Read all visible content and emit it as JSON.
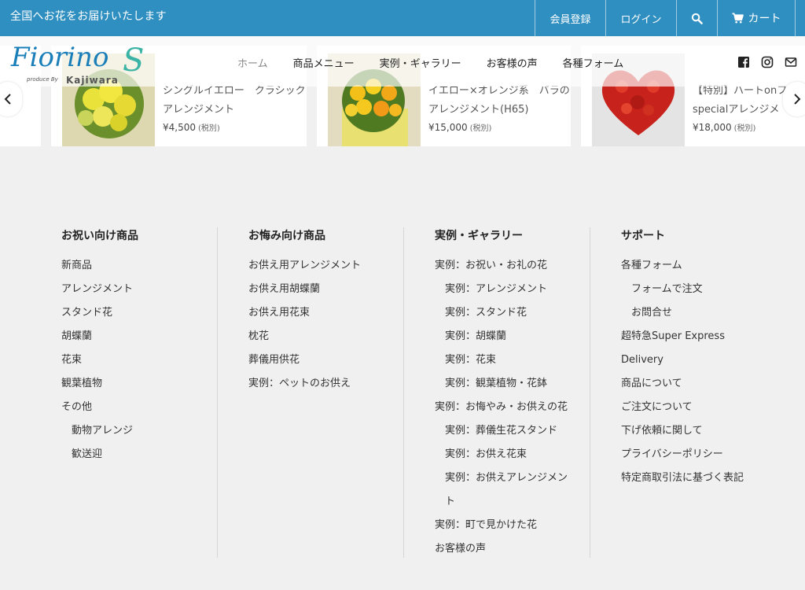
{
  "topbar": {
    "tagline": "全国へお花をお届けいたします",
    "register": "会員登録",
    "login": "ログイン",
    "cart": "カート"
  },
  "logo": {
    "wordmark": "Fiorino",
    "tail": "S",
    "produce_by": "produce By",
    "brand": "Kajiwara"
  },
  "mainnav": [
    "ホーム",
    "商品メニュー",
    "実例・ギャラリー",
    "お客様の声",
    "各種フォーム"
  ],
  "carousel": [
    {
      "name": "シングルイエロー　クラシック　アレンジメント",
      "price": "¥4,500",
      "tax": "(税別)"
    },
    {
      "name": "イエロー×オレンジ系　バラのアレンジメント(H65)",
      "price": "¥15,000",
      "tax": "(税別)"
    },
    {
      "name": "【特別】ハートonファイアーspecialアレンジメ",
      "price": "¥18,000",
      "tax": "(税別)"
    }
  ],
  "footer": {
    "columns": [
      {
        "heading": "お祝い向け商品",
        "items": [
          {
            "label": "新商品",
            "sub": false
          },
          {
            "label": "アレンジメント",
            "sub": false
          },
          {
            "label": "スタンド花",
            "sub": false
          },
          {
            "label": "胡蝶蘭",
            "sub": false
          },
          {
            "label": "花束",
            "sub": false
          },
          {
            "label": "観葉植物",
            "sub": false
          },
          {
            "label": "その他",
            "sub": false
          },
          {
            "label": "動物アレンジ",
            "sub": true
          },
          {
            "label": "歓送迎",
            "sub": true
          }
        ]
      },
      {
        "heading": "お悔み向け商品",
        "items": [
          {
            "label": "お供え用アレンジメント",
            "sub": false
          },
          {
            "label": "お供え用胡蝶蘭",
            "sub": false
          },
          {
            "label": "お供え用花束",
            "sub": false
          },
          {
            "label": "枕花",
            "sub": false
          },
          {
            "label": "葬儀用供花",
            "sub": false
          },
          {
            "label": "実例：ペットのお供え",
            "sub": false
          }
        ]
      },
      {
        "heading": "実例・ギャラリー",
        "items": [
          {
            "label": "実例：お祝い・お礼の花",
            "sub": false
          },
          {
            "label": "実例：アレンジメント",
            "sub": true
          },
          {
            "label": "実例：スタンド花",
            "sub": true
          },
          {
            "label": "実例：胡蝶蘭",
            "sub": true
          },
          {
            "label": "実例：花束",
            "sub": true
          },
          {
            "label": "実例：観葉植物・花鉢",
            "sub": true
          },
          {
            "label": "実例：お悔やみ・お供えの花",
            "sub": false
          },
          {
            "label": "実例：葬儀生花スタンド",
            "sub": true
          },
          {
            "label": "実例：お供え花束",
            "sub": true
          },
          {
            "label": "実例：お供えアレンジメント",
            "sub": true,
            "wrap": true
          },
          {
            "label": "実例：町で見かけた花",
            "sub": false
          },
          {
            "label": "お客様の声",
            "sub": false
          }
        ]
      },
      {
        "heading": "サポート",
        "items": [
          {
            "label": "各種フォーム",
            "sub": false
          },
          {
            "label": "フォームで注文",
            "sub": true
          },
          {
            "label": "お問合せ",
            "sub": true
          },
          {
            "label": "超特急Super Express Delivery",
            "sub": false,
            "wrap": true
          },
          {
            "label": "商品について",
            "sub": false
          },
          {
            "label": "ご注文について",
            "sub": false
          },
          {
            "label": "下げ依頼に関して",
            "sub": false
          },
          {
            "label": "プライバシーポリシー",
            "sub": false
          },
          {
            "label": "特定商取引法に基づく表記",
            "sub": false
          }
        ]
      }
    ]
  },
  "colors": {
    "topbar": "#2f8fc0",
    "logo_blue": "#1a7fb8",
    "logo_teal": "#3bb3a5",
    "footer_bg": "#f0f0f0"
  },
  "icons": [
    "search-icon",
    "cart-icon",
    "facebook-icon",
    "instagram-icon",
    "mail-icon",
    "chevron-left-icon",
    "chevron-right-icon"
  ]
}
